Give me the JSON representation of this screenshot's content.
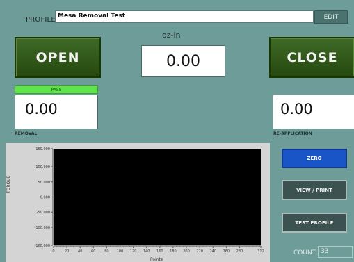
{
  "header": {
    "profile_label": "PROFILE:",
    "profile_name": "Mesa Removal Test",
    "edit_label": "EDIT"
  },
  "controls": {
    "open_label": "OPEN",
    "close_label": "CLOSE"
  },
  "torque": {
    "unit": "oz-in",
    "value": "0.00"
  },
  "removal": {
    "status": "PASS",
    "value": "0.00",
    "caption": "REMOVAL"
  },
  "reapplication": {
    "value": "0.00",
    "caption": "RE-APPLICATION"
  },
  "side_buttons": {
    "zero": "ZERO",
    "view_print": "VIEW / PRINT",
    "test_profile": "TEST PROFILE"
  },
  "counter": {
    "label": "COUNT:",
    "value": "33"
  },
  "colors": {
    "background": "#6e9c98",
    "action_green": "#2f5a18",
    "pass_green": "#5fe34a",
    "zero_blue": "#1a55c8",
    "plot_background": "#000000"
  },
  "chart_data": {
    "type": "line",
    "title": "",
    "xlabel": "Points",
    "ylabel": "TORQUE",
    "xlim": [
      0,
      312
    ],
    "ylim": [
      -160,
      160
    ],
    "x_ticks": [
      "0",
      "20",
      "40",
      "60",
      "80",
      "100",
      "120",
      "140",
      "160",
      "180",
      "200",
      "220",
      "240",
      "260",
      "280",
      "312"
    ],
    "y_ticks": [
      "160.000",
      "100.000",
      "50.000",
      "0.000",
      "-50.000",
      "-100.000",
      "-160.000"
    ],
    "series": []
  }
}
